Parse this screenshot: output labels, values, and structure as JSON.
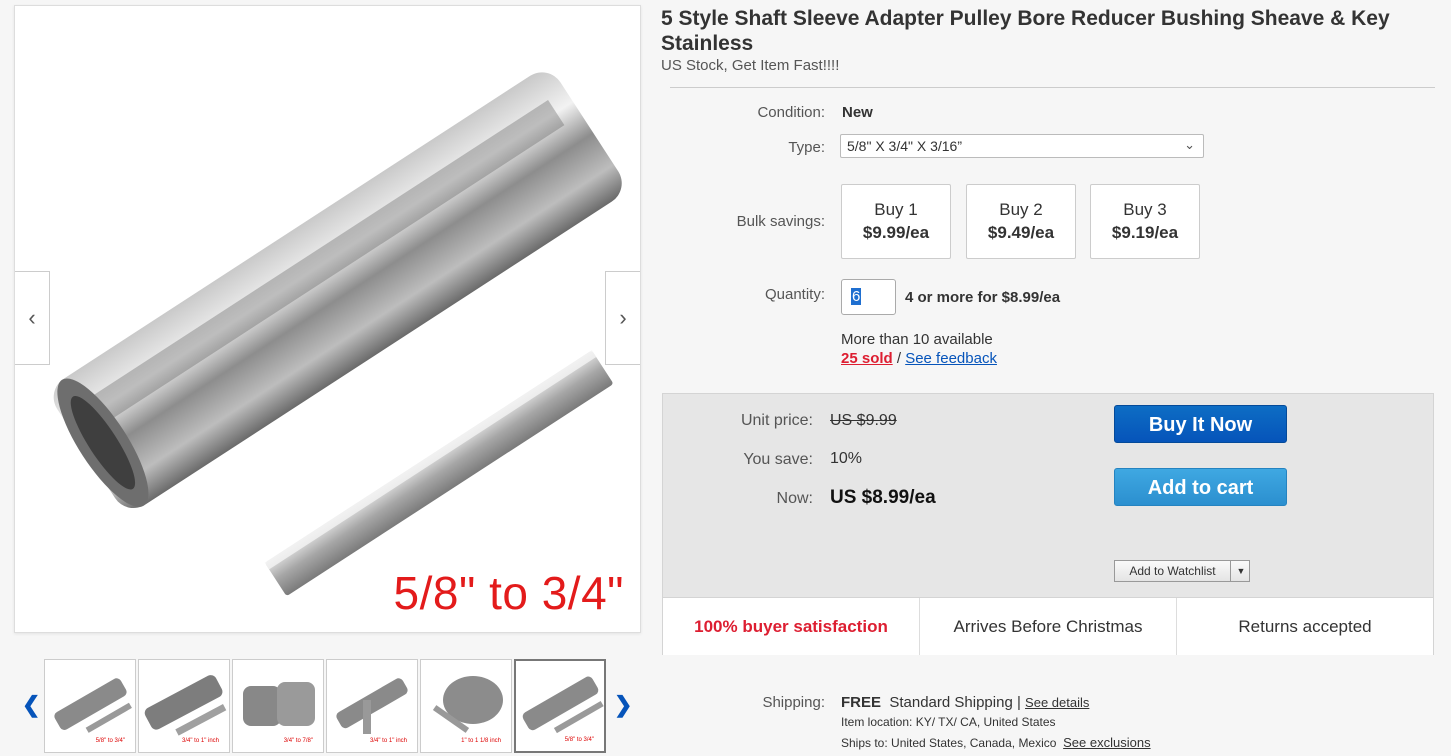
{
  "product": {
    "title": "5 Style Shaft Sleeve Adapter Pulley Bore Reducer Bushing Sheave & Key Stainless",
    "subtitle": "US Stock, Get Item Fast!!!!"
  },
  "gallery": {
    "main_caption": "5/8\" to 3/4\"",
    "prev_icon": "chevron-left-icon",
    "next_icon": "chevron-right-icon",
    "thumbnails": [
      {
        "caption": "5/8\" to 3/4\""
      },
      {
        "caption": "3/4\" to 1\" inch"
      },
      {
        "caption": "3/4\" to 7/8\""
      },
      {
        "caption": "3/4\" to 1\" inch"
      },
      {
        "caption": "1\" to 1 1/8 inch"
      },
      {
        "caption": "5/8\" to 3/4\""
      }
    ]
  },
  "details": {
    "condition_label": "Condition:",
    "condition_value": "New",
    "type_label": "Type:",
    "type_value": "5/8\" X 3/4\" X 3/16”",
    "bulk_label": "Bulk savings:",
    "bulk": [
      {
        "label": "Buy 1",
        "price": "$9.99/ea"
      },
      {
        "label": "Buy 2",
        "price": "$9.49/ea"
      },
      {
        "label": "Buy 3",
        "price": "$9.19/ea"
      }
    ],
    "quantity_label": "Quantity:",
    "quantity_value": "6",
    "quantity_note": "4 or more for $8.99/ea",
    "available": "More than 10 available",
    "sold": "25 sold",
    "sep": "/",
    "feedback": "See feedback"
  },
  "pricing": {
    "unit_price_label": "Unit price:",
    "unit_price_value": "US $9.99",
    "save_label": "You save:",
    "save_value": "10%",
    "now_label": "Now:",
    "now_value": "US $8.99/ea",
    "buy_now": "Buy It Now",
    "add_to_cart": "Add to cart",
    "watchlist": "Add to Watchlist"
  },
  "badges": [
    "100% buyer satisfaction",
    "Arrives Before Christmas",
    "Returns accepted"
  ],
  "shipping": {
    "label": "Shipping:",
    "free": "FREE",
    "method": "Standard Shipping",
    "pipe": "|",
    "details_link": "See details",
    "location": "Item location:  KY/ TX/ CA, United States",
    "ships_to": "Ships to:  United States, Canada, Mexico",
    "exclusions_link": "See exclusions"
  },
  "colors": {
    "buy_now": "#0654ba",
    "add_to_cart": "#2b8fcf",
    "sold_red": "#dd1e31",
    "link_blue": "#0654ba"
  }
}
